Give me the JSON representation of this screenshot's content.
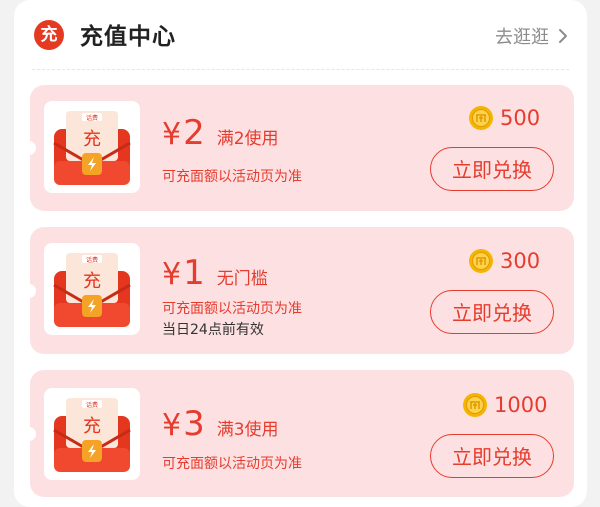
{
  "header": {
    "badge": "充",
    "title": "充值中心",
    "link": "去逛逛"
  },
  "cards": [
    {
      "thumb_label": "充",
      "thumb_tag": "话费",
      "yen": "¥",
      "amount": "2",
      "condition": "满2使用",
      "desc": "可充面额以活动页为准",
      "extra": "",
      "coins": "500",
      "button": "立即兑换"
    },
    {
      "thumb_label": "充",
      "thumb_tag": "话费",
      "yen": "¥",
      "amount": "1",
      "condition": "无门槛",
      "desc": "可充面额以活动页为准",
      "extra": "当日24点前有效",
      "coins": "300",
      "button": "立即兑换"
    },
    {
      "thumb_label": "充",
      "thumb_tag": "话费",
      "yen": "¥",
      "amount": "3",
      "condition": "满3使用",
      "desc": "可充面额以活动页为准",
      "extra": "",
      "coins": "1000",
      "button": "立即兑换"
    }
  ],
  "colors": {
    "accent": "#e63c2e",
    "card_bg": "#fde1e2",
    "coin": "#f5b400"
  }
}
